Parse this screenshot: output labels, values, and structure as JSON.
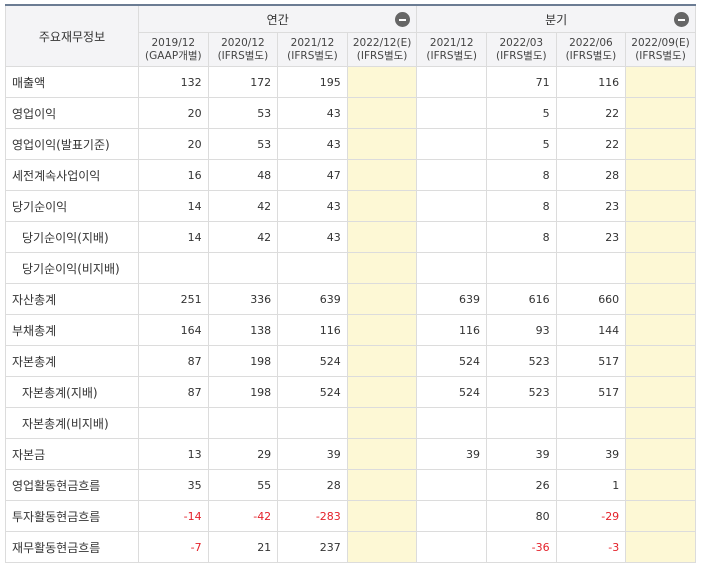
{
  "header": {
    "corner": "주요재무정보",
    "groups": [
      {
        "label": "연간"
      },
      {
        "label": "분기"
      }
    ],
    "periods": [
      {
        "date": "2019/12",
        "std": "(GAAP개별)"
      },
      {
        "date": "2020/12",
        "std": "(IFRS별도)"
      },
      {
        "date": "2021/12",
        "std": "(IFRS별도)"
      },
      {
        "date": "2022/12(E)",
        "std": "(IFRS별도)"
      },
      {
        "date": "2021/12",
        "std": "(IFRS별도)"
      },
      {
        "date": "2022/03",
        "std": "(IFRS별도)"
      },
      {
        "date": "2022/06",
        "std": "(IFRS별도)"
      },
      {
        "date": "2022/09(E)",
        "std": "(IFRS별도)"
      }
    ]
  },
  "rows": [
    {
      "label": "매출액",
      "sub": false,
      "values": [
        "132",
        "172",
        "195",
        "",
        "",
        "71",
        "116",
        ""
      ]
    },
    {
      "label": "영업이익",
      "sub": false,
      "values": [
        "20",
        "53",
        "43",
        "",
        "",
        "5",
        "22",
        ""
      ]
    },
    {
      "label": "영업이익(발표기준)",
      "sub": false,
      "values": [
        "20",
        "53",
        "43",
        "",
        "",
        "5",
        "22",
        ""
      ]
    },
    {
      "label": "세전계속사업이익",
      "sub": false,
      "values": [
        "16",
        "48",
        "47",
        "",
        "",
        "8",
        "28",
        ""
      ]
    },
    {
      "label": "당기순이익",
      "sub": false,
      "values": [
        "14",
        "42",
        "43",
        "",
        "",
        "8",
        "23",
        ""
      ]
    },
    {
      "label": "당기순이익(지배)",
      "sub": true,
      "values": [
        "14",
        "42",
        "43",
        "",
        "",
        "8",
        "23",
        ""
      ]
    },
    {
      "label": "당기순이익(비지배)",
      "sub": true,
      "values": [
        "",
        "",
        "",
        "",
        "",
        "",
        "",
        ""
      ]
    },
    {
      "label": "자산총계",
      "sub": false,
      "values": [
        "251",
        "336",
        "639",
        "",
        "639",
        "616",
        "660",
        ""
      ]
    },
    {
      "label": "부채총계",
      "sub": false,
      "values": [
        "164",
        "138",
        "116",
        "",
        "116",
        "93",
        "144",
        ""
      ]
    },
    {
      "label": "자본총계",
      "sub": false,
      "values": [
        "87",
        "198",
        "524",
        "",
        "524",
        "523",
        "517",
        ""
      ]
    },
    {
      "label": "자본총계(지배)",
      "sub": true,
      "values": [
        "87",
        "198",
        "524",
        "",
        "524",
        "523",
        "517",
        ""
      ]
    },
    {
      "label": "자본총계(비지배)",
      "sub": true,
      "values": [
        "",
        "",
        "",
        "",
        "",
        "",
        "",
        ""
      ]
    },
    {
      "label": "자본금",
      "sub": false,
      "values": [
        "13",
        "29",
        "39",
        "",
        "39",
        "39",
        "39",
        ""
      ]
    },
    {
      "label": "영업활동현금흐름",
      "sub": false,
      "values": [
        "35",
        "55",
        "28",
        "",
        "",
        "26",
        "1",
        ""
      ]
    },
    {
      "label": "투자활동현금흐름",
      "sub": false,
      "values": [
        "-14",
        "-42",
        "-283",
        "",
        "",
        "80",
        "-29",
        ""
      ]
    },
    {
      "label": "재무활동현금흐름",
      "sub": false,
      "values": [
        "-7",
        "21",
        "237",
        "",
        "",
        "-36",
        "-3",
        ""
      ]
    }
  ]
}
